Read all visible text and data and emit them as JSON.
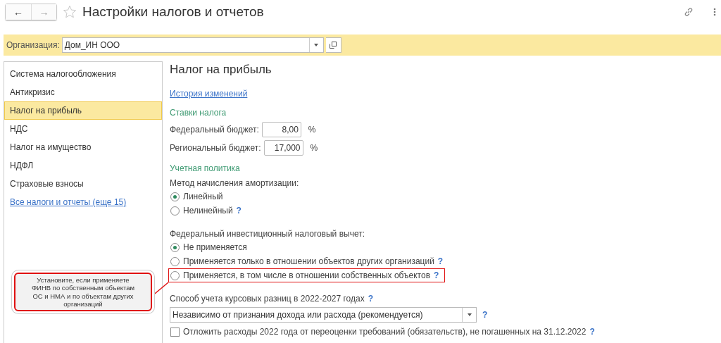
{
  "window": {
    "title": "Настройки налогов и отчетов",
    "back": "←",
    "forward": "→",
    "favorite": false
  },
  "organization": {
    "label": "Организация:",
    "value": "Дом_ИН ООО"
  },
  "sidebar": {
    "items": [
      {
        "label": "Система налогообложения",
        "selected": false,
        "kind": "item"
      },
      {
        "label": "Антикризис",
        "selected": false,
        "kind": "item"
      },
      {
        "label": "Налог на прибыль",
        "selected": true,
        "kind": "item"
      },
      {
        "label": "НДС",
        "selected": false,
        "kind": "item"
      },
      {
        "label": "Налог на имущество",
        "selected": false,
        "kind": "item"
      },
      {
        "label": "НДФЛ",
        "selected": false,
        "kind": "item"
      },
      {
        "label": "Страховые взносы",
        "selected": false,
        "kind": "item"
      },
      {
        "label": "Все налоги и отчеты (еще 15)",
        "selected": false,
        "kind": "link"
      }
    ]
  },
  "content": {
    "title": "Налог на прибыль",
    "history_link": "История изменений",
    "rates": {
      "heading": "Ставки налога",
      "fields": [
        {
          "label": "Федеральный бюджет:",
          "value": "8,00",
          "unit": "%"
        },
        {
          "label": "Региональный бюджет:",
          "value": "17,000",
          "unit": "%"
        }
      ]
    },
    "policy": {
      "heading": "Учетная политика",
      "groups": [
        {
          "label": "Метод начисления амортизации:",
          "options": [
            {
              "label": "Линейный",
              "selected": true,
              "highlighted": false
            },
            {
              "label": "Нелинейный",
              "help": "?",
              "selected": false,
              "highlighted": false
            }
          ]
        },
        {
          "label": "Федеральный инвестиционный налоговый вычет:",
          "options": [
            {
              "label": "Не применяется",
              "selected": true,
              "highlighted": false
            },
            {
              "label": "Применяется только в отношении объектов других организаций",
              "help": "?",
              "selected": false,
              "highlighted": false
            },
            {
              "label": "Применяется, в том числе в отношении собственных объектов",
              "help": "?",
              "selected": false,
              "highlighted": true
            }
          ]
        }
      ]
    },
    "exchange": {
      "label": "Способ учета курсовых разниц в 2022-2027 годах",
      "label_help": "?",
      "value": "Независимо от признания дохода или расхода (рекомендуется)",
      "value_help": "?"
    },
    "defer": {
      "label": "Отложить расходы 2022 года от переоценки требований (обязательств), не погашенных на 31.12.2022",
      "help": "?",
      "checked": false
    }
  },
  "callout": {
    "text": "Установите, если применяете ФИНВ по собственным объектам ОС и НМА и по объектам других организаций"
  }
}
